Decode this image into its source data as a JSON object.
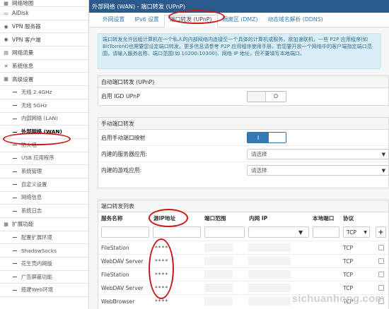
{
  "sidebar": {
    "items": [
      {
        "label": "网络地图",
        "icon": "map-icon",
        "level": "top"
      },
      {
        "label": "AiDisk",
        "icon": "disk-icon",
        "level": "top"
      },
      {
        "label": "VPN 服务器",
        "icon": "vpn-server-icon",
        "level": "top"
      },
      {
        "label": "VPN 客户端",
        "icon": "vpn-client-icon",
        "level": "top"
      },
      {
        "label": "网络流量",
        "icon": "traffic-icon",
        "level": "top"
      },
      {
        "label": "系统信息",
        "icon": "info-icon",
        "level": "top"
      },
      {
        "label": "高级设置",
        "icon": "settings-icon",
        "level": "top"
      },
      {
        "label": "无线 2.4GHz",
        "level": "sub"
      },
      {
        "label": "无线 5GHz",
        "level": "sub"
      },
      {
        "label": "内部网络 (LAN)",
        "level": "sub"
      },
      {
        "label": "外部网络 (WAN)",
        "level": "sub",
        "active": true
      },
      {
        "label": "防火墙",
        "level": "sub"
      },
      {
        "label": "USB 应用程序",
        "level": "sub"
      },
      {
        "label": "系统管理",
        "level": "sub"
      },
      {
        "label": "自定义设置",
        "level": "sub"
      },
      {
        "label": "网络信息",
        "level": "sub"
      },
      {
        "label": "系统日志",
        "level": "sub"
      },
      {
        "label": "扩展功能",
        "icon": "extension-icon",
        "level": "top"
      },
      {
        "label": "配置扩展环境",
        "level": "sub"
      },
      {
        "label": "ShadowSocks",
        "level": "sub"
      },
      {
        "label": "花生壳内网版",
        "level": "sub"
      },
      {
        "label": "广告屏蔽功能",
        "level": "sub"
      },
      {
        "label": "搭建Web环境",
        "level": "sub"
      }
    ]
  },
  "header": {
    "title": "外部网络 (WAN) - 端口转发 (UPnP)"
  },
  "tabs": [
    {
      "label": "外网设置"
    },
    {
      "label": "IPv6 设置"
    },
    {
      "label": "端口转发 (UPnP)",
      "active": true
    },
    {
      "label": "隔离区 (DMZ)"
    },
    {
      "label": "动态域名解析 (DDNS)"
    }
  ],
  "info": {
    "text": "端口转发允许远程计算机在一个私人的内部网络内连接至一个具体的计算机或服务。欲加速联机，一些 P2P 应用程序(如 BitTorrent)也需要您设定端口转发。更多信息请参考 P2P 应用程序使用手册。若您要开放一个网络中的客户端指定端口范围，请输入服务名称、端口范围(如 10200:10300)、网络 IP 地址，但不要填写本地端口。"
  },
  "auto": {
    "heading": "自动端口转发 (UPnP)",
    "igd_label": "启用 IGD UPnP",
    "igd_state": "O"
  },
  "manual": {
    "heading": "手动端口转发",
    "enable_label": "启用手动端口映射",
    "enable_state": "I",
    "server_label": "内建的服务器应用:",
    "server_value": "请选择",
    "game_label": "内建的游戏应用:",
    "game_value": "请选择"
  },
  "list": {
    "heading": "端口转发列表",
    "columns": {
      "service": "服务名称",
      "source": "源IP地址",
      "port_range": "端口范围",
      "intranet_ip": "内网 IP",
      "local_port": "本地端口",
      "protocol": "协议"
    },
    "protocol_default": "TCP",
    "add_label": "+",
    "rows": [
      {
        "service": "FileStation",
        "source": "****",
        "protocol": "TCP"
      },
      {
        "service": "WebDAV Server",
        "source": "****",
        "protocol": "TCP"
      },
      {
        "service": "FileStation",
        "source": "****",
        "protocol": "TCP"
      },
      {
        "service": "WebDAV Server",
        "source": "****",
        "protocol": "TCP"
      },
      {
        "service": "WebBrowser",
        "source": "****",
        "protocol": "TCP"
      }
    ]
  },
  "watermark": "sichuanhong.com",
  "colors": {
    "header": "#2b5a8c",
    "link": "#337ab7",
    "highlight_ring": "#c8191b",
    "info_bg": "#d9edf7"
  }
}
